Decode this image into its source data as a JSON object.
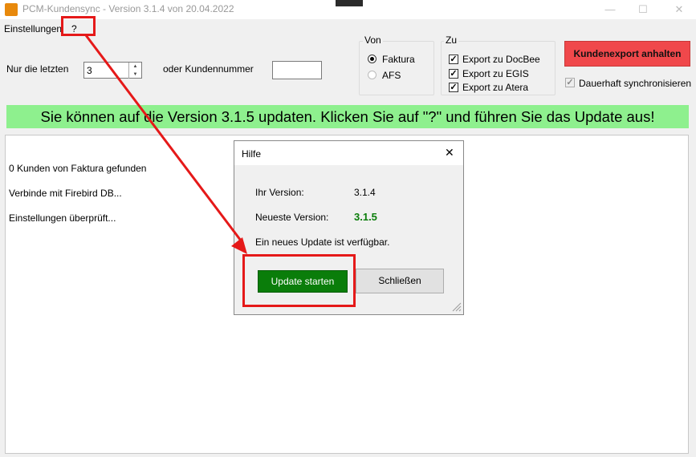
{
  "window": {
    "title": "PCM-Kundensync - Version 3.1.4 von 20.04.2022",
    "minimize_glyph": "—",
    "maximize_glyph": "☐",
    "close_glyph": "✕"
  },
  "menu": {
    "settings": "Einstellungen",
    "help": "?"
  },
  "filters": {
    "last_label": "Nur die letzten",
    "last_value": "3",
    "customer_label": "oder Kundennummer",
    "customer_value": ""
  },
  "von": {
    "title": "Von",
    "options": [
      "Faktura",
      "AFS"
    ],
    "selected": "Faktura"
  },
  "zu": {
    "title": "Zu",
    "options": [
      "Export zu DocBee",
      "Export zu EGIS",
      "Export zu Atera"
    ]
  },
  "stop_button": "Kundenexport anhalten",
  "sync_label": "Dauerhaft synchronisieren",
  "banner": "Sie können auf die Version 3.1.5 updaten. Klicken Sie auf \"?\" und führen Sie das Update aus!",
  "log": [
    "0 Kunden von Faktura gefunden",
    "Verbinde mit Firebird DB...",
    "Einstellungen überprüft..."
  ],
  "dialog": {
    "title": "Hilfe",
    "your_version_label": "Ihr Version:",
    "your_version": "3.1.4",
    "latest_label": "Neueste Version:",
    "latest": "3.1.5",
    "message": "Ein neues Update ist verfügbar.",
    "start_button": "Update starten",
    "close_button": "Schließen",
    "close_glyph": "✕"
  },
  "colors": {
    "annotation": "#e51919",
    "banner": "#8ef08e",
    "stop_button": "#f0484b",
    "update_button": "#0a7d0a"
  }
}
